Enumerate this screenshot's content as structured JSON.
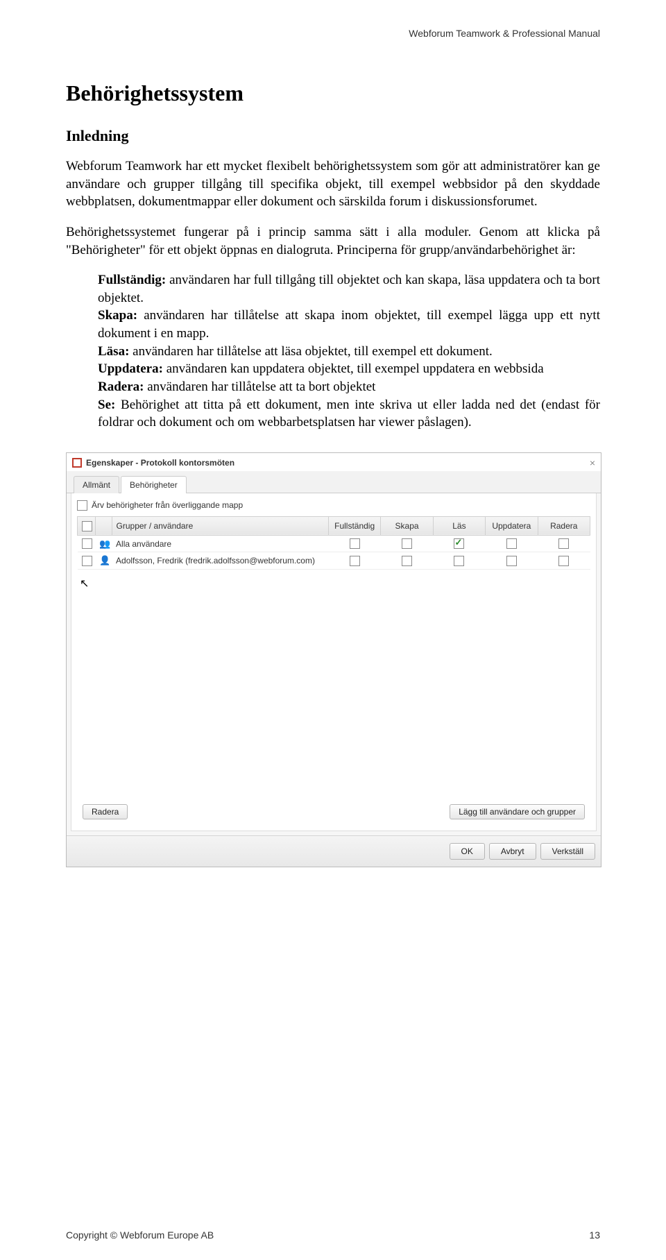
{
  "header": {
    "right": "Webforum Teamwork & Professional Manual"
  },
  "h1": "Behörighetssystem",
  "h2": "Inledning",
  "para1": "Webforum Teamwork har ett mycket flexibelt behörighetssystem som gör att administratörer kan ge användare och grupper tillgång till specifika objekt, till exempel webbsidor på den skyddade webbplatsen, dokumentmappar eller dokument och särskilda forum i diskussionsforumet.",
  "para2": "Behörighetssystemet fungerar på i princip samma sätt i alla moduler. Genom att klicka på \"Behörigheter\" för ett objekt öppnas en dialogruta. Principerna för grupp/användarbehörighet är:",
  "definitions": [
    {
      "term": "Fullständig:",
      "text": " användaren har full tillgång till objektet och kan skapa, läsa uppdatera och ta bort objektet."
    },
    {
      "term": "Skapa:",
      "text": " användaren har tillåtelse att skapa inom objektet, till exempel lägga upp ett nytt dokument i en mapp."
    },
    {
      "term": "Läsa:",
      "text": " användaren har tillåtelse att läsa objektet, till exempel ett dokument."
    },
    {
      "term": "Uppdatera:",
      "text": " användaren kan uppdatera objektet, till exempel uppdatera en webbsida"
    },
    {
      "term": "Radera:",
      "text": " användaren har tillåtelse att ta bort objektet"
    },
    {
      "term": "Se:",
      "text": " Behörighet att titta på ett dokument, men inte skriva ut eller ladda ned det (endast för foldrar och dokument och om webbarbetsplatsen har viewer påslagen)."
    }
  ],
  "dialog": {
    "title": "Egenskaper - Protokoll kontorsmöten",
    "tabs": {
      "general": "Allmänt",
      "permissions": "Behörigheter"
    },
    "inherit_label": "Ärv behörigheter från överliggande mapp",
    "columns": {
      "name": "Grupper / användare",
      "full": "Fullständig",
      "create": "Skapa",
      "read": "Läs",
      "update": "Uppdatera",
      "delete": "Radera"
    },
    "rows": [
      {
        "icon": "group",
        "name": "Alla användare",
        "full": false,
        "create": false,
        "read": true,
        "update": false,
        "delete": false
      },
      {
        "icon": "user",
        "name": "Adolfsson, Fredrik (fredrik.adolfsson@webforum.com)",
        "full": false,
        "create": false,
        "read": false,
        "update": false,
        "delete": false
      }
    ],
    "buttons": {
      "delete": "Radera",
      "add": "Lägg till användare och grupper",
      "ok": "OK",
      "cancel": "Avbryt",
      "apply": "Verkställ"
    }
  },
  "footer": {
    "copyright": "Copyright © Webforum Europe AB",
    "page": "13"
  }
}
